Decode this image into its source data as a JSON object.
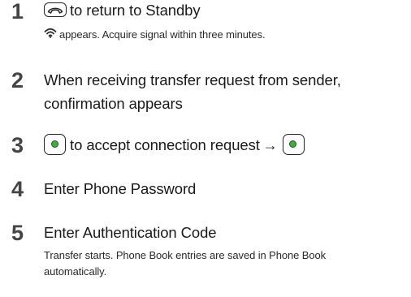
{
  "steps": [
    {
      "number": "1",
      "title": "to return to Standby",
      "note": "appears. Acquire signal within three minutes."
    },
    {
      "number": "2",
      "title_line1": "When receiving transfer request from sender,",
      "title_line2": "confirmation appears"
    },
    {
      "number": "3",
      "title": "to accept connection request",
      "arrow": "→"
    },
    {
      "number": "4",
      "title": "Enter Phone Password"
    },
    {
      "number": "5",
      "title": "Enter Authentication Code",
      "note_line1": "Transfer starts. Phone Book entries are saved in Phone Book",
      "note_line2": "automatically."
    }
  ],
  "icons": {
    "end_key": "end-call-key-icon",
    "signal": "infrared-signal-icon",
    "center_key": "center-select-key-icon"
  },
  "colors": {
    "number": "#444444",
    "text": "#1a1a1a",
    "center_key_dot": "#3fae3f"
  }
}
